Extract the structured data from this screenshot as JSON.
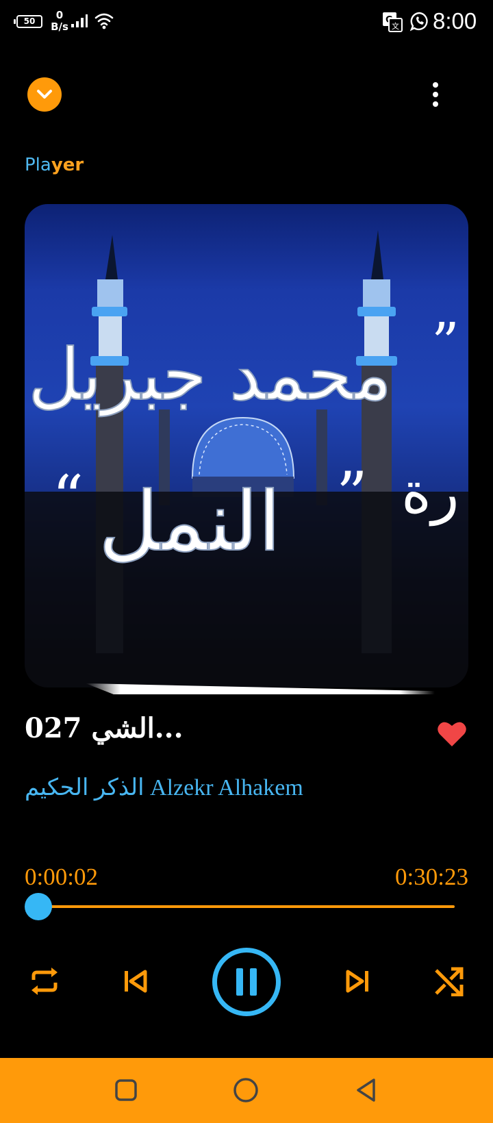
{
  "status_bar": {
    "battery_level": "50",
    "net_speed_value": "0",
    "net_speed_unit": "B/s",
    "time": "8:00",
    "icons": [
      "battery-icon",
      "signal-icon",
      "wifi-icon",
      "translate-icon",
      "whatsapp-icon"
    ]
  },
  "header": {
    "title_part1": "Pla",
    "title_part2": "yer",
    "collapse_icon": "chevron-down-icon",
    "menu_icon": "more-vert-icon"
  },
  "artwork": {
    "text_line1": "محمد جبريل",
    "text_line2": "النمل",
    "text_line2_prefix": "رة"
  },
  "track": {
    "title": "027 الشي...",
    "artist": "الذكر الحكيم Alzekr Alhakem",
    "favorite": true
  },
  "progress": {
    "elapsed": "0:00:02",
    "total": "0:30:23",
    "fraction": 0.001
  },
  "controls": [
    "repeat-icon",
    "skip-previous-icon",
    "pause-icon",
    "skip-next-icon",
    "shuffle-icon"
  ],
  "nav_bar": [
    "recent-apps-icon",
    "home-icon",
    "back-icon"
  ],
  "colors": {
    "accent_orange": "#ff9a0a",
    "accent_blue": "#36b7f5",
    "heart_red": "#f04646",
    "background": "#000000"
  }
}
